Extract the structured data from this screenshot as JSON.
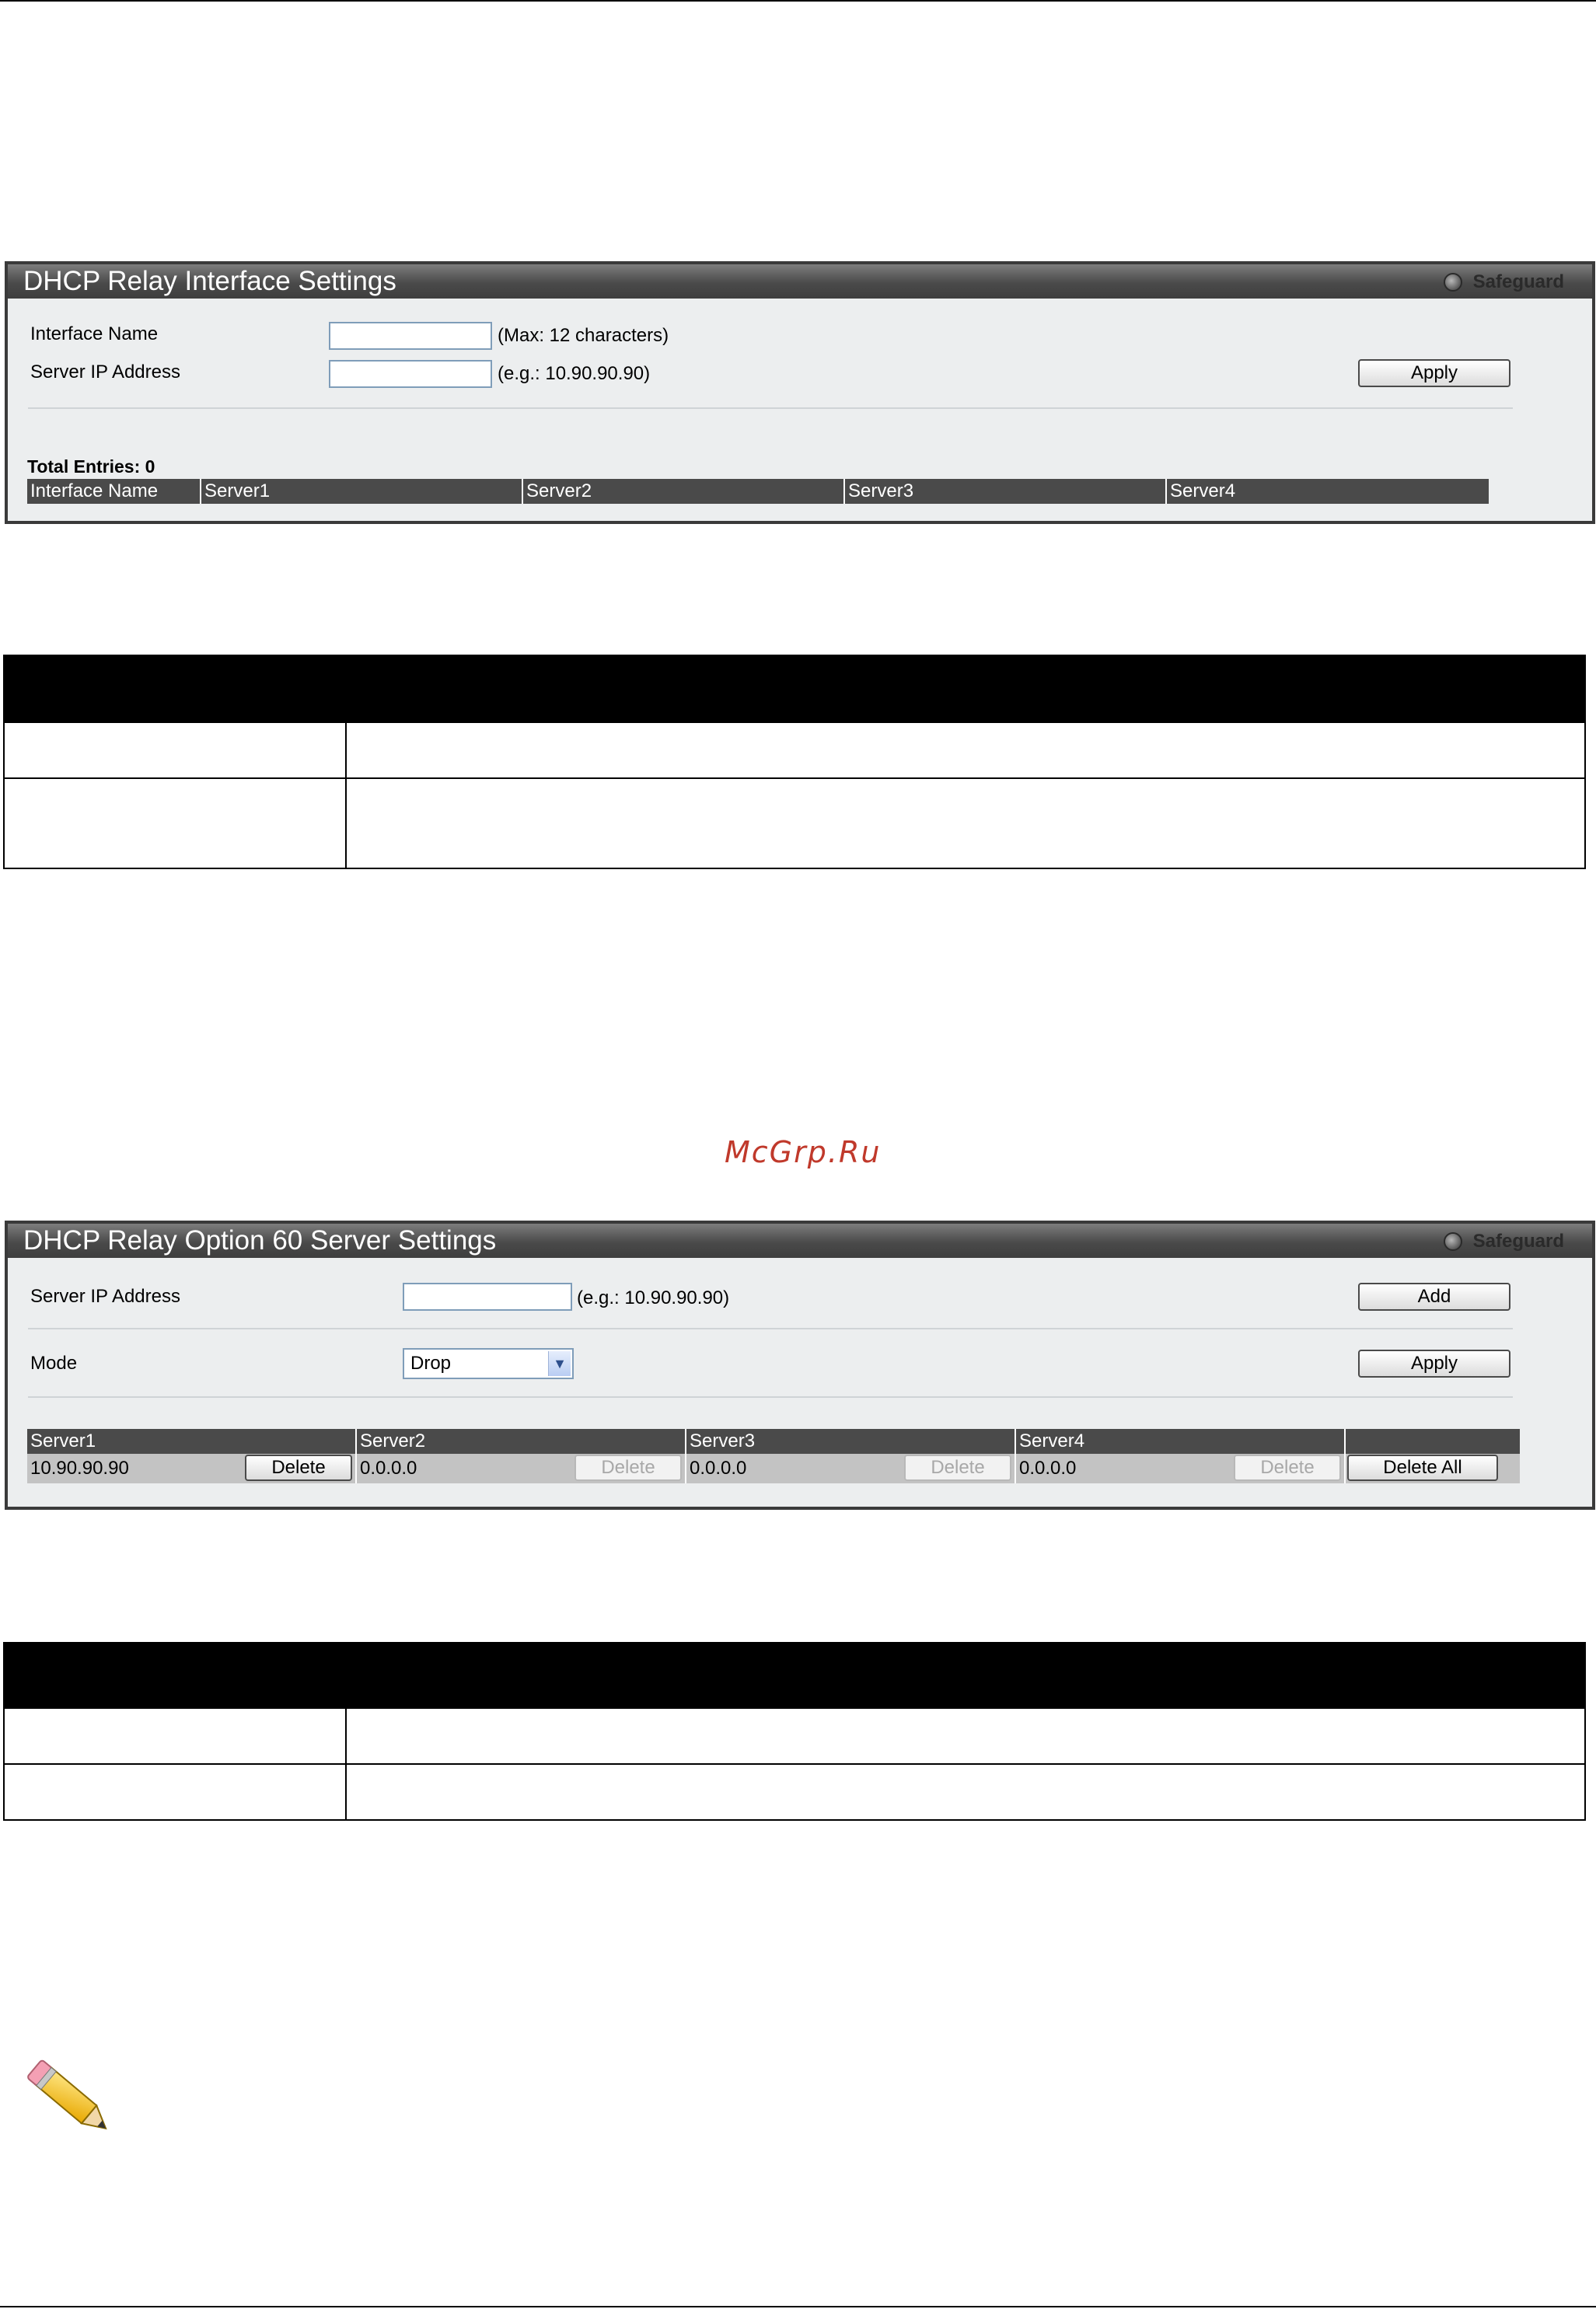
{
  "interface_panel": {
    "title": "DHCP Relay Interface Settings",
    "safeguard_label": "Safeguard",
    "interface_name_label": "Interface Name",
    "interface_name_hint": "(Max: 12 characters)",
    "interface_name_value": "",
    "server_ip_label": "Server IP Address",
    "server_ip_hint": "(e.g.: 10.90.90.90)",
    "server_ip_value": "",
    "apply_label": "Apply",
    "total_entries": "Total Entries: 0",
    "columns": [
      "Interface Name",
      "Server1",
      "Server2",
      "Server3",
      "Server4"
    ]
  },
  "option60_panel": {
    "title": "DHCP Relay Option 60 Server Settings",
    "safeguard_label": "Safeguard",
    "server_ip_label": "Server IP Address",
    "server_ip_hint": "(e.g.: 10.90.90.90)",
    "server_ip_value": "",
    "add_label": "Add",
    "mode_label": "Mode",
    "mode_value": "Drop",
    "apply_label": "Apply",
    "columns": [
      "Server1",
      "Server2",
      "Server3",
      "Server4",
      ""
    ],
    "row": [
      {
        "value": "10.90.90.90",
        "delete_label": "Delete",
        "enabled": true
      },
      {
        "value": "0.0.0.0",
        "delete_label": "Delete",
        "enabled": false
      },
      {
        "value": "0.0.0.0",
        "delete_label": "Delete",
        "enabled": false
      },
      {
        "value": "0.0.0.0",
        "delete_label": "Delete",
        "enabled": false
      }
    ],
    "delete_all_label": "Delete All"
  },
  "watermark": "McGrp.Ru",
  "colors": {
    "panel_border": "#3a3a3a",
    "panel_bg": "#eceeef",
    "table_header_bg": "#4a4a4a",
    "table_row_bg": "#c3c3c3",
    "watermark": "#c0392b"
  }
}
